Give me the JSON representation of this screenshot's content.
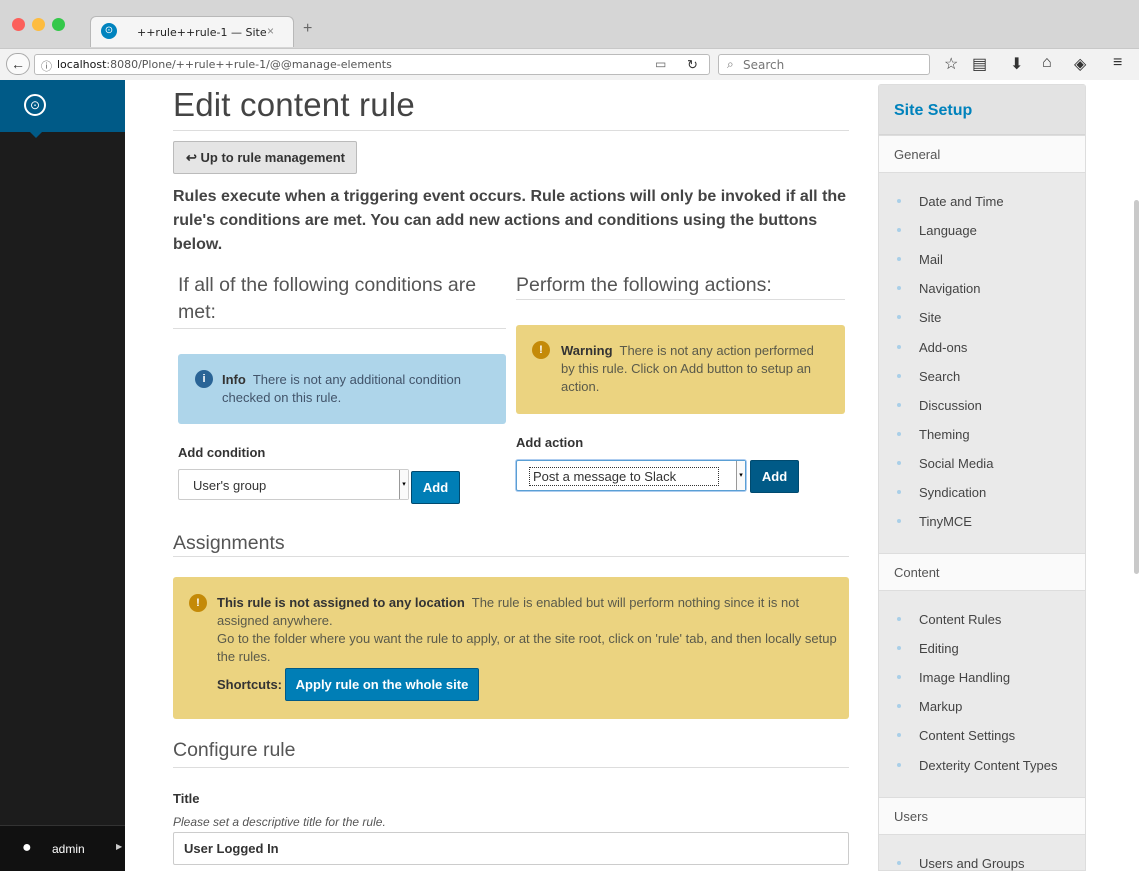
{
  "browser": {
    "tab_title": "++rule++rule-1 — Site",
    "tab_close": "×",
    "new_tab": "+",
    "url_host": "localhost",
    "url_rest": ":8080/Plone/++rule++rule-1/@@manage-elements",
    "search_placeholder": "Search",
    "info_glyph": "ⓘ",
    "back_glyph": "←",
    "reader_glyph": "📖",
    "reload_glyph": "C"
  },
  "toolbar": {
    "logo_glyph": "⊙",
    "user_name": "admin",
    "user_glyph": "👤",
    "arrow_glyph": "▶"
  },
  "main": {
    "title": "Edit content rule",
    "up_button": "↩ Up to rule management",
    "intro": "Rules execute when a triggering event occurs. Rule actions will only be invoked if all the rule's conditions are met. You can add new actions and conditions using the buttons below.",
    "conditions": {
      "heading": "If all of the following conditions are met:",
      "info_title": "Info",
      "info_text": "There is not any additional condition checked on this rule.",
      "add_label": "Add condition",
      "select_value": "User's group",
      "add_button": "Add"
    },
    "actions": {
      "heading": "Perform the following actions:",
      "warn_title": "Warning",
      "warn_text": "There is not any action performed by this rule. Click on Add button to setup an action.",
      "add_label": "Add action",
      "select_value": "Post a message to Slack",
      "add_button": "Add"
    },
    "assignments": {
      "heading": "Assignments",
      "warn_title": "This rule is not assigned to any location",
      "warn_text": "The rule is enabled but will perform nothing since it is not assigned anywhere.",
      "warn_text2": "Go to the folder where you want the rule to apply, or at the site root, click on 'rule' tab, and then locally setup the rules.",
      "shortcuts_label": "Shortcuts:",
      "apply_button": "Apply rule on the whole site"
    },
    "configure": {
      "heading": "Configure rule",
      "title_label": "Title",
      "title_help": "Please set a descriptive title for the rule.",
      "title_value": "User Logged In"
    }
  },
  "sidebar": {
    "title": "Site Setup",
    "groups": [
      {
        "name": "General",
        "items": [
          "Date and Time",
          "Language",
          "Mail",
          "Navigation",
          "Site",
          "Add-ons",
          "Search",
          "Discussion",
          "Theming",
          "Social Media",
          "Syndication",
          "TinyMCE"
        ]
      },
      {
        "name": "Content",
        "items": [
          "Content Rules",
          "Editing",
          "Image Handling",
          "Markup",
          "Content Settings",
          "Dexterity Content Types"
        ]
      },
      {
        "name": "Users",
        "items": [
          "Users and Groups"
        ]
      }
    ]
  },
  "colors": {
    "accent": "#007eb6",
    "toolbar_bg": "#1c1c1c",
    "info_bg": "#aed5ea",
    "warn_bg": "#ebd380"
  }
}
